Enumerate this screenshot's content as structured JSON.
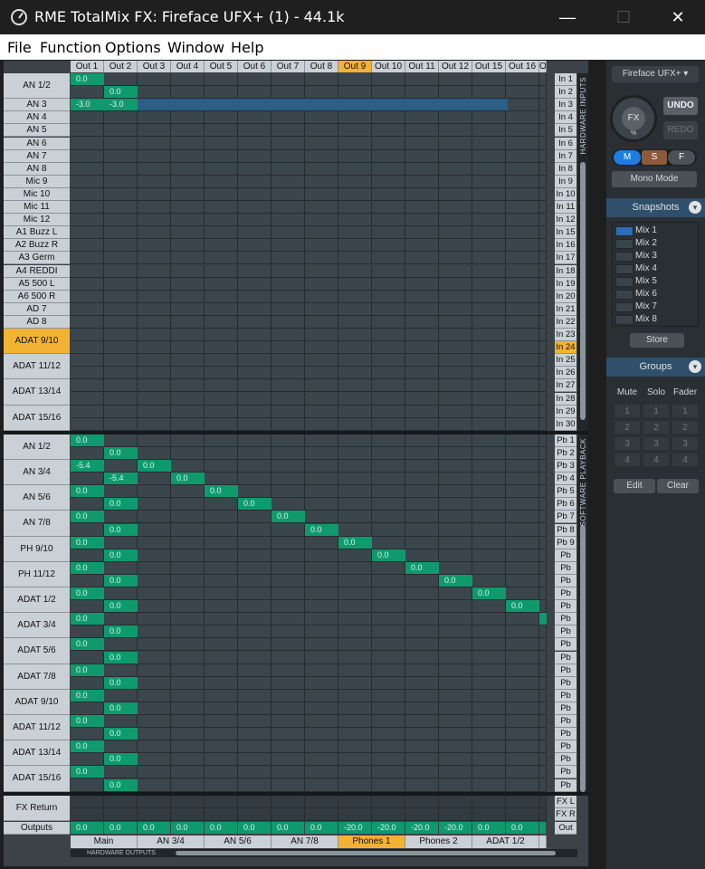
{
  "window": {
    "title": "RME TotalMix FX: Fireface UFX+ (1) - 44.1k",
    "minimize": "—",
    "maximize": "☐",
    "close": "✕"
  },
  "menu": [
    "File",
    "Function",
    "Options",
    "Window",
    "Help"
  ],
  "columns": [
    "Out 1",
    "Out 2",
    "Out 3",
    "Out 4",
    "Out 5",
    "Out 6",
    "Out 7",
    "Out 8",
    "Out 9",
    "Out 10",
    "Out 11",
    "Out 12",
    "Out 15",
    "Out 16",
    "Ou"
  ],
  "active_column": 8,
  "hw_input_labels": [
    {
      "label": "AN 1/2",
      "rows": 2
    },
    {
      "label": "AN 3",
      "rows": 1
    },
    {
      "label": "AN 4",
      "rows": 1
    },
    {
      "label": "AN 5",
      "rows": 1
    },
    {
      "label": "AN 6",
      "rows": 1
    },
    {
      "label": "AN 7",
      "rows": 1
    },
    {
      "label": "AN 8",
      "rows": 1
    },
    {
      "label": "Mic 9",
      "rows": 1
    },
    {
      "label": "Mic 10",
      "rows": 1
    },
    {
      "label": "Mic 11",
      "rows": 1
    },
    {
      "label": "Mic 12",
      "rows": 1
    },
    {
      "label": "A1 Buzz L",
      "rows": 1
    },
    {
      "label": "A2 Buzz R",
      "rows": 1
    },
    {
      "label": "A3 Germ",
      "rows": 1
    },
    {
      "label": "A4 REDDI",
      "rows": 1
    },
    {
      "label": "A5 500 L",
      "rows": 1
    },
    {
      "label": "A6 500 R",
      "rows": 1
    },
    {
      "label": "AD 7",
      "rows": 1
    },
    {
      "label": "AD 8",
      "rows": 1
    },
    {
      "label": "ADAT 9/10",
      "rows": 2,
      "active": true
    },
    {
      "label": "ADAT 11/12",
      "rows": 2
    },
    {
      "label": "ADAT 13/14",
      "rows": 2
    },
    {
      "label": "ADAT 15/16",
      "rows": 2
    }
  ],
  "hw_input_channels": [
    "In 1",
    "In 2",
    "In 3",
    "In 4",
    "In 5",
    "In 6",
    "In 7",
    "In 8",
    "In 9",
    "In 10",
    "In 11",
    "In 12",
    "In 15",
    "In 16",
    "In 17",
    "In 18",
    "In 19",
    "In 20",
    "In 21",
    "In 22",
    "In 23",
    "In 24",
    "In 25",
    "In 26",
    "In 27",
    "In 28",
    "In 29",
    "In 30"
  ],
  "active_hw_channel": 21,
  "hw_input_values": [
    {
      "row": 0,
      "col": 0,
      "value": "0.0"
    },
    {
      "row": 1,
      "col": 1,
      "value": "0.0"
    },
    {
      "row": 2,
      "col": 0,
      "value": "-3.0"
    },
    {
      "row": 2,
      "col": 1,
      "value": "-3.0"
    }
  ],
  "sw_playback_labels": [
    {
      "label": "AN 1/2",
      "rows": 2
    },
    {
      "label": "AN 3/4",
      "rows": 2
    },
    {
      "label": "AN 5/6",
      "rows": 2
    },
    {
      "label": "AN 7/8",
      "rows": 2
    },
    {
      "label": "PH 9/10",
      "rows": 2
    },
    {
      "label": "PH 11/12",
      "rows": 2
    },
    {
      "label": "ADAT 1/2",
      "rows": 2
    },
    {
      "label": "ADAT 3/4",
      "rows": 2
    },
    {
      "label": "ADAT 5/6",
      "rows": 2
    },
    {
      "label": "ADAT 7/8",
      "rows": 2
    },
    {
      "label": "ADAT 9/10",
      "rows": 2
    },
    {
      "label": "ADAT 11/12",
      "rows": 2
    },
    {
      "label": "ADAT 13/14",
      "rows": 2
    },
    {
      "label": "ADAT 15/16",
      "rows": 2
    }
  ],
  "sw_playback_channels": [
    "Pb 1",
    "Pb 2",
    "Pb 3",
    "Pb 4",
    "Pb 5",
    "Pb 6",
    "Pb 7",
    "Pb 8",
    "Pb 9",
    "Pb 10",
    "Pb 11",
    "Pb 12",
    "Pb 15",
    "Pb 16",
    "Pb 17",
    "Pb 18",
    "Pb 19",
    "Pb 20",
    "Pb 21",
    "Pb 22",
    "Pb 23",
    "Pb 24",
    "Pb 25",
    "Pb 26",
    "Pb 27",
    "Pb 28",
    "Pb 29",
    "Pb 30"
  ],
  "sw_playback_values": [
    {
      "row": 0,
      "col": 0,
      "value": "0.0"
    },
    {
      "row": 1,
      "col": 1,
      "value": "0.0"
    },
    {
      "row": 2,
      "col": 0,
      "value": "-5.4"
    },
    {
      "row": 2,
      "col": 2,
      "value": "0.0"
    },
    {
      "row": 3,
      "col": 1,
      "value": "-5.4"
    },
    {
      "row": 3,
      "col": 3,
      "value": "0.0"
    },
    {
      "row": 4,
      "col": 0,
      "value": "0.0"
    },
    {
      "row": 4,
      "col": 4,
      "value": "0.0"
    },
    {
      "row": 5,
      "col": 1,
      "value": "0.0"
    },
    {
      "row": 5,
      "col": 5,
      "value": "0.0"
    },
    {
      "row": 6,
      "col": 0,
      "value": "0.0"
    },
    {
      "row": 6,
      "col": 6,
      "value": "0.0"
    },
    {
      "row": 7,
      "col": 1,
      "value": "0.0"
    },
    {
      "row": 7,
      "col": 7,
      "value": "0.0"
    },
    {
      "row": 8,
      "col": 0,
      "value": "0.0"
    },
    {
      "row": 8,
      "col": 8,
      "value": "0.0"
    },
    {
      "row": 9,
      "col": 1,
      "value": "0.0"
    },
    {
      "row": 9,
      "col": 9,
      "value": "0.0"
    },
    {
      "row": 10,
      "col": 0,
      "value": "0.0"
    },
    {
      "row": 10,
      "col": 10,
      "value": "0.0"
    },
    {
      "row": 11,
      "col": 1,
      "value": "0.0"
    },
    {
      "row": 11,
      "col": 11,
      "value": "0.0"
    },
    {
      "row": 12,
      "col": 0,
      "value": "0.0"
    },
    {
      "row": 12,
      "col": 12,
      "value": "0.0"
    },
    {
      "row": 13,
      "col": 1,
      "value": "0.0"
    },
    {
      "row": 13,
      "col": 13,
      "value": "0.0"
    },
    {
      "row": 14,
      "col": 0,
      "value": "0.0"
    },
    {
      "row": 14,
      "col": 14,
      "value": ""
    },
    {
      "row": 15,
      "col": 1,
      "value": "0.0"
    },
    {
      "row": 16,
      "col": 0,
      "value": "0.0"
    },
    {
      "row": 17,
      "col": 1,
      "value": "0.0"
    },
    {
      "row": 18,
      "col": 0,
      "value": "0.0"
    },
    {
      "row": 19,
      "col": 1,
      "value": "0.0"
    },
    {
      "row": 20,
      "col": 0,
      "value": "0.0"
    },
    {
      "row": 21,
      "col": 1,
      "value": "0.0"
    },
    {
      "row": 22,
      "col": 0,
      "value": "0.0"
    },
    {
      "row": 23,
      "col": 1,
      "value": "0.0"
    },
    {
      "row": 24,
      "col": 0,
      "value": "0.0"
    },
    {
      "row": 25,
      "col": 1,
      "value": "0.0"
    },
    {
      "row": 26,
      "col": 0,
      "value": "0.0"
    },
    {
      "row": 27,
      "col": 1,
      "value": "0.0"
    }
  ],
  "fx_return": {
    "label": "FX Return",
    "channels": [
      "FX L",
      "FX R"
    ]
  },
  "outputs": {
    "label": "Outputs",
    "channel": "Out",
    "values": [
      "0.0",
      "0.0",
      "0.0",
      "0.0",
      "0.0",
      "0.0",
      "0.0",
      "0.0",
      "-20.0",
      "-20.0",
      "-20.0",
      "-20.0",
      "0.0",
      "0.0",
      ""
    ]
  },
  "output_groups": [
    {
      "label": "Main",
      "span": 2
    },
    {
      "label": "AN 3/4",
      "span": 2
    },
    {
      "label": "AN 5/6",
      "span": 2
    },
    {
      "label": "AN 7/8",
      "span": 2
    },
    {
      "label": "Phones 1",
      "span": 2,
      "active": true
    },
    {
      "label": "Phones 2",
      "span": 2
    },
    {
      "label": "ADAT 1/2",
      "span": 2
    },
    {
      "label": "",
      "span": 1
    }
  ],
  "section_labels": {
    "hardware_inputs": "HARDWARE INPUTS",
    "software_playback": "SOFTWARE PLAYBACK",
    "hardware_outputs": "HARDWARE OUTPUTS"
  },
  "sidebar": {
    "device": "Fireface UFX+",
    "fx_label": "FX",
    "fx_sub": "%",
    "undo": "UNDO",
    "redo": "REDO",
    "msf": [
      "M",
      "S",
      "F"
    ],
    "mono_mode": "Mono Mode",
    "snapshots_header": "Snapshots",
    "snapshots": [
      "Mix 1",
      "Mix 2",
      "Mix 3",
      "Mix 4",
      "Mix 5",
      "Mix 6",
      "Mix 7",
      "Mix 8"
    ],
    "store": "Store",
    "groups_header": "Groups",
    "group_cols": [
      "Mute",
      "Solo",
      "Fader"
    ],
    "group_rows": [
      "1",
      "2",
      "3",
      "4"
    ],
    "edit": "Edit",
    "clear": "Clear"
  }
}
